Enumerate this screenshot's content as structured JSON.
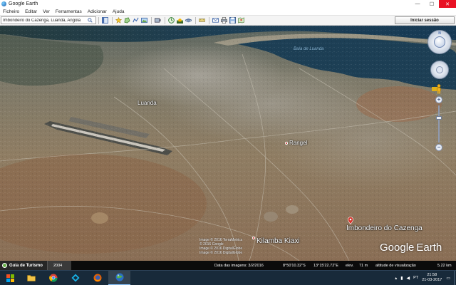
{
  "window": {
    "title": "Google Earth",
    "min_glyph": "—",
    "max_glyph": "☐",
    "close_glyph": "✕"
  },
  "menu": {
    "items": [
      "Ficheiro",
      "Editar",
      "Ver",
      "Ferramentas",
      "Adicionar",
      "Ajuda"
    ]
  },
  "toolbar": {
    "search_value": "Imbondeiro do Cazenga, Luanda, Angola",
    "login_label": "Iniciar sessão",
    "buttons": [
      "sidebar-toggle",
      "placemark",
      "polygon",
      "path",
      "image-overlay",
      "record-tour",
      "historical-imagery",
      "sun",
      "planets",
      "ruler",
      "email",
      "print",
      "save-image",
      "view-in-maps"
    ]
  },
  "map": {
    "places": {
      "luanda": "Luanda",
      "rangel": "Rangel",
      "kilamba": "Kilamba Kiaxi",
      "imbondeiro": "Imbondeiro do Cazenga"
    },
    "bay_label": "Baía de Luanda",
    "attribution": [
      "Image © 2016 TerraMetrics",
      "© 2016 Google",
      "Image © 2016 DigitalGlobe",
      "Image © 2016 DigitalGlobe"
    ],
    "brand_google": "Google",
    "brand_earth": "Earth",
    "colors": {
      "ocean": "#1d3f55",
      "land": "#8c7a62",
      "city": "#9a9690",
      "pin": "#c21a1a"
    }
  },
  "nav": {
    "north": "N",
    "zoom_in": "+",
    "zoom_out": "−"
  },
  "bottom": {
    "tour_label": "Guia de Turismo",
    "year": "2004"
  },
  "status": {
    "imagery_date": "Data das imagens: 3/2/2016",
    "latitude": "8°50'10.32\"S",
    "longitude": "13°15'22.72\"E",
    "elevation_label": "elev.",
    "elevation": "71 m",
    "eye_altitude": "altitude de visualização",
    "eye_value": "5.22 km"
  },
  "taskbar": {
    "apps": [
      "file-explorer",
      "chrome",
      "kodi",
      "firefox",
      "google-earth"
    ],
    "lang": "PT",
    "time": "21:58",
    "date": "21-03-2017"
  }
}
